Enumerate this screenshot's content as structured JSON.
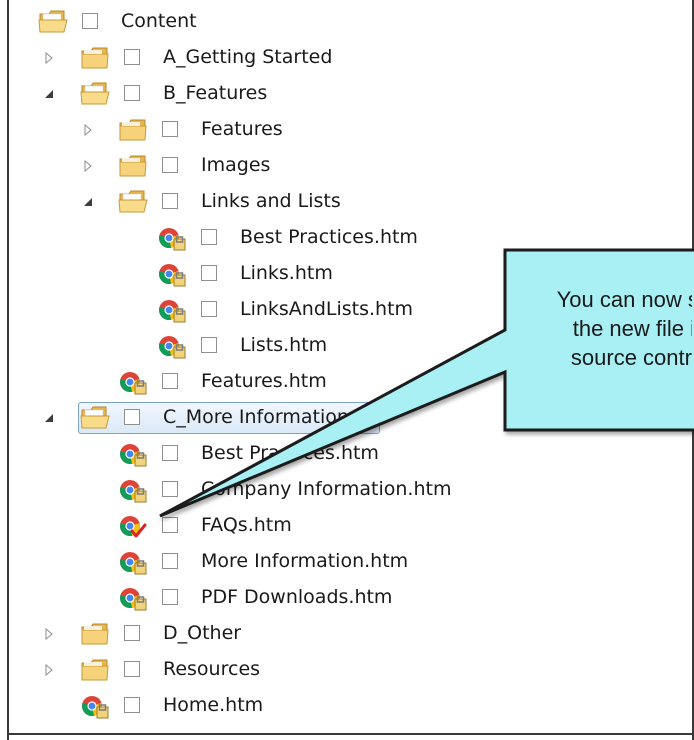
{
  "tree": [
    {
      "label": "Content",
      "type": "folder",
      "indent": 0,
      "expander": "none"
    },
    {
      "label": "A_Getting Started",
      "type": "folder",
      "indent": 1,
      "expander": "collapsed"
    },
    {
      "label": "B_Features",
      "type": "folder",
      "indent": 1,
      "expander": "expanded"
    },
    {
      "label": "Features",
      "type": "folder",
      "indent": 2,
      "expander": "collapsed"
    },
    {
      "label": "Images",
      "type": "folder",
      "indent": 2,
      "expander": "collapsed"
    },
    {
      "label": "Links and Lists",
      "type": "folder",
      "indent": 2,
      "expander": "expanded"
    },
    {
      "label": "Best Practices.htm",
      "type": "file",
      "indent": 3,
      "expander": "none"
    },
    {
      "label": "Links.htm",
      "type": "file",
      "indent": 3,
      "expander": "none"
    },
    {
      "label": "LinksAndLists.htm",
      "type": "file",
      "indent": 3,
      "expander": "none"
    },
    {
      "label": "Lists.htm",
      "type": "file",
      "indent": 3,
      "expander": "none"
    },
    {
      "label": "Features.htm",
      "type": "file",
      "indent": 2,
      "expander": "none"
    },
    {
      "label": "C_More Information",
      "type": "folder",
      "indent": 1,
      "expander": "expanded",
      "selected": true
    },
    {
      "label": "Best Practices.htm",
      "type": "file",
      "indent": 2,
      "expander": "none"
    },
    {
      "label": "Company Information.htm",
      "type": "file",
      "indent": 2,
      "expander": "none"
    },
    {
      "label": "FAQs.htm",
      "type": "file-checked",
      "indent": 2,
      "expander": "none"
    },
    {
      "label": "More Information.htm",
      "type": "file",
      "indent": 2,
      "expander": "none"
    },
    {
      "label": "PDF Downloads.htm",
      "type": "file",
      "indent": 2,
      "expander": "none"
    },
    {
      "label": "D_Other",
      "type": "folder",
      "indent": 1,
      "expander": "collapsed"
    },
    {
      "label": "Resources",
      "type": "folder",
      "indent": 1,
      "expander": "collapsed"
    },
    {
      "label": "Home.htm",
      "type": "file",
      "indent": 1,
      "expander": "none"
    }
  ],
  "callout": {
    "text_line1": "You can now see",
    "text_line2": "the new file in",
    "text_line3": "source control",
    "fill_color": "#a8f0f3",
    "border_color": "#1a1a1a"
  },
  "colors": {
    "folder_body": "#f6d27a",
    "folder_tab": "#e8b44c",
    "selection_border": "#7da2ce",
    "checkmark_red": "#d8232a"
  }
}
